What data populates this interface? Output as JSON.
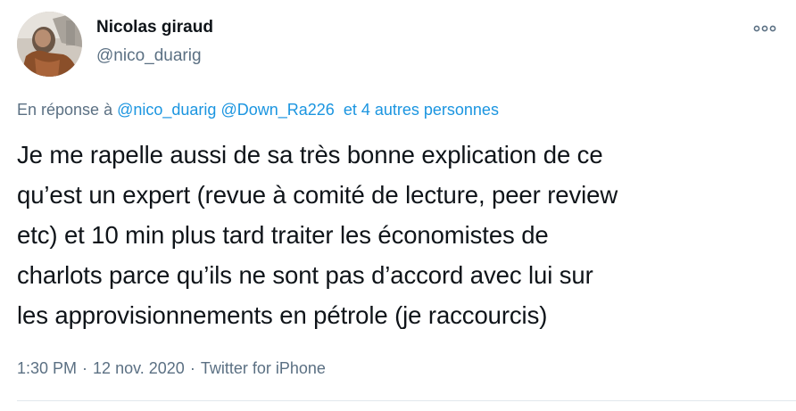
{
  "author": {
    "display_name": "Nicolas giraud",
    "handle": "@nico_duarig"
  },
  "reply_context": {
    "prefix": "En réponse à",
    "mention_1": "@nico_duarig",
    "mention_2": "@Down_Ra226",
    "others": "et 4 autres personnes"
  },
  "tweet": {
    "line_1": "Je me rapelle aussi de sa très bonne explication de ce",
    "line_2": "qu’est un expert (revue à comité de lecture, peer review",
    "line_3": "etc) et 10 min plus tard traiter les économistes de",
    "line_4": "charlots parce qu’ils ne sont pas d’accord avec lui sur",
    "line_5": "les approvisionnements en pétrole (je raccourcis)"
  },
  "meta": {
    "time": "1:30 PM",
    "date": "12 nov. 2020",
    "separator": "·",
    "source": "Twitter for iPhone"
  },
  "icons": {
    "more": "more-options-icon",
    "avatar": "user-avatar"
  },
  "colors": {
    "link": "#1b95e0",
    "secondary_text": "#5b7083",
    "primary_text": "#0f1419",
    "divider": "#e1e8ed"
  }
}
